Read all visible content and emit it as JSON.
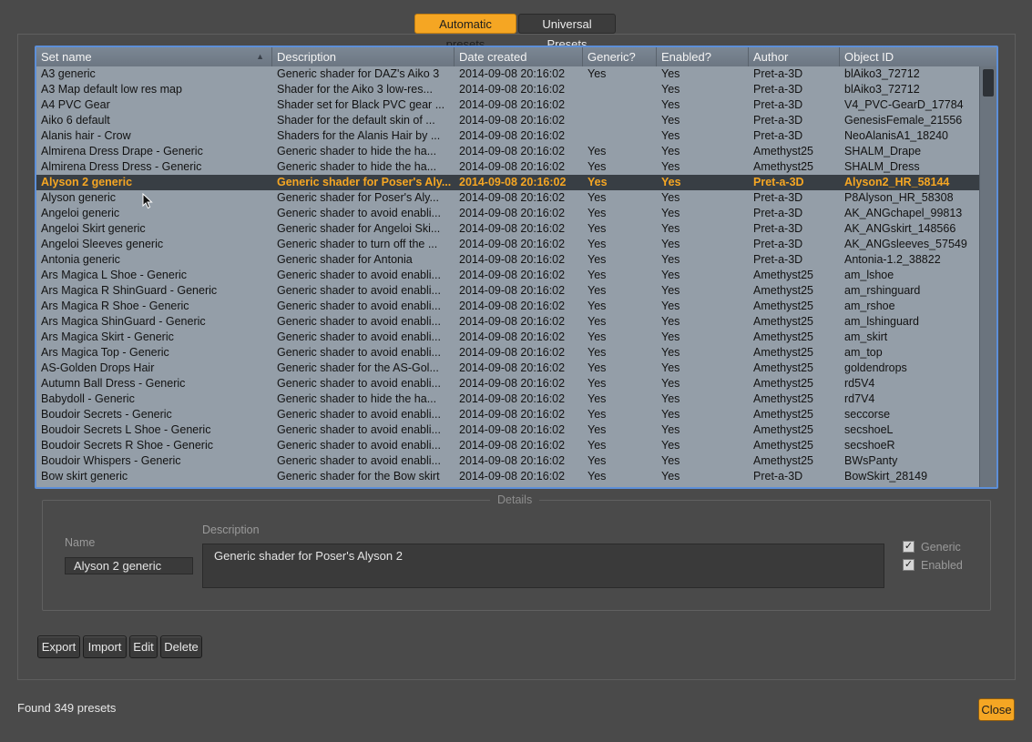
{
  "tabs": [
    {
      "label": "Automatic presets",
      "active": true
    },
    {
      "label": "Universal Presets",
      "active": false
    }
  ],
  "table": {
    "columns": [
      "Set name",
      "Description",
      "Date created",
      "Generic?",
      "Enabled?",
      "Author",
      "Object ID"
    ],
    "sorted_column": "Set name",
    "sort_direction": "ascending",
    "selected_index": 7,
    "rows": [
      [
        "A3 generic",
        "Generic shader for DAZ's Aiko 3",
        "2014-09-08 20:16:02",
        "Yes",
        "Yes",
        "Pret-a-3D",
        "blAiko3_72712"
      ],
      [
        "A3 Map default low res map",
        "Shader for the Aiko 3 low-res...",
        "2014-09-08 20:16:02",
        "",
        "Yes",
        "Pret-a-3D",
        "blAiko3_72712"
      ],
      [
        "A4 PVC Gear",
        "Shader set for Black PVC gear ...",
        "2014-09-08 20:16:02",
        "",
        "Yes",
        "Pret-a-3D",
        "V4_PVC-GearD_17784"
      ],
      [
        "Aiko 6 default",
        "Shader for the default skin of ...",
        "2014-09-08 20:16:02",
        "",
        "Yes",
        "Pret-a-3D",
        "GenesisFemale_21556"
      ],
      [
        "Alanis hair - Crow",
        "Shaders for the Alanis Hair by ...",
        "2014-09-08 20:16:02",
        "",
        "Yes",
        "Pret-a-3D",
        "NeoAlanisA1_18240"
      ],
      [
        "Almirena Dress Drape - Generic",
        "Generic shader to  hide the ha...",
        "2014-09-08 20:16:02",
        "Yes",
        "Yes",
        "Amethyst25",
        "SHALM_Drape"
      ],
      [
        "Almirena Dress Dress - Generic",
        "Generic shader to  hide the ha...",
        "2014-09-08 20:16:02",
        "Yes",
        "Yes",
        "Amethyst25",
        "SHALM_Dress"
      ],
      [
        "Alyson 2 generic",
        "Generic shader for Poser's Aly...",
        "2014-09-08 20:16:02",
        "Yes",
        "Yes",
        "Pret-a-3D",
        "Alyson2_HR_58144"
      ],
      [
        "Alyson generic",
        "Generic shader for Poser's Aly...",
        "2014-09-08 20:16:02",
        "Yes",
        "Yes",
        "Pret-a-3D",
        "P8Alyson_HR_58308"
      ],
      [
        "Angeloi generic",
        "Generic shader to avoid enabli...",
        "2014-09-08 20:16:02",
        "Yes",
        "Yes",
        "Pret-a-3D",
        "AK_ANGchapel_99813"
      ],
      [
        "Angeloi Skirt generic",
        "Generic shader for Angeloi Ski...",
        "2014-09-08 20:16:02",
        "Yes",
        "Yes",
        "Pret-a-3D",
        "AK_ANGskirt_148566"
      ],
      [
        "Angeloi Sleeves generic",
        "Generic shader to turn off the ...",
        "2014-09-08 20:16:02",
        "Yes",
        "Yes",
        "Pret-a-3D",
        "AK_ANGsleeves_57549"
      ],
      [
        "Antonia generic",
        "Generic shader for Antonia",
        "2014-09-08 20:16:02",
        "Yes",
        "Yes",
        "Pret-a-3D",
        "Antonia-1.2_38822"
      ],
      [
        "Ars Magica L Shoe - Generic",
        "Generic shader to avoid enabli...",
        "2014-09-08 20:16:02",
        "Yes",
        "Yes",
        "Amethyst25",
        "am_lshoe"
      ],
      [
        "Ars Magica R ShinGuard - Generic",
        "Generic shader to avoid enabli...",
        "2014-09-08 20:16:02",
        "Yes",
        "Yes",
        "Amethyst25",
        "am_rshinguard"
      ],
      [
        "Ars Magica R Shoe - Generic",
        "Generic shader to avoid enabli...",
        "2014-09-08 20:16:02",
        "Yes",
        "Yes",
        "Amethyst25",
        "am_rshoe"
      ],
      [
        "Ars Magica ShinGuard - Generic",
        "Generic shader to avoid enabli...",
        "2014-09-08 20:16:02",
        "Yes",
        "Yes",
        "Amethyst25",
        "am_lshinguard"
      ],
      [
        "Ars Magica Skirt - Generic",
        "Generic shader to avoid enabli...",
        "2014-09-08 20:16:02",
        "Yes",
        "Yes",
        "Amethyst25",
        "am_skirt"
      ],
      [
        "Ars Magica Top - Generic",
        "Generic shader to avoid enabli...",
        "2014-09-08 20:16:02",
        "Yes",
        "Yes",
        "Amethyst25",
        "am_top"
      ],
      [
        "AS-Golden Drops Hair",
        "Generic shader for the AS-Gol...",
        "2014-09-08 20:16:02",
        "Yes",
        "Yes",
        "Amethyst25",
        "goldendrops"
      ],
      [
        "Autumn Ball Dress - Generic",
        "Generic shader to avoid enabli...",
        "2014-09-08 20:16:02",
        "Yes",
        "Yes",
        "Amethyst25",
        "rd5V4"
      ],
      [
        "Babydoll - Generic",
        "Generic shader to hide the ha...",
        "2014-09-08 20:16:02",
        "Yes",
        "Yes",
        "Amethyst25",
        "rd7V4"
      ],
      [
        "Boudoir Secrets - Generic",
        "Generic shader to avoid enabli...",
        "2014-09-08 20:16:02",
        "Yes",
        "Yes",
        "Amethyst25",
        "seccorse"
      ],
      [
        "Boudoir Secrets L Shoe - Generic",
        "Generic shader to avoid enabli...",
        "2014-09-08 20:16:02",
        "Yes",
        "Yes",
        "Amethyst25",
        "secshoeL"
      ],
      [
        "Boudoir Secrets R Shoe - Generic",
        "Generic shader to avoid enabli...",
        "2014-09-08 20:16:02",
        "Yes",
        "Yes",
        "Amethyst25",
        "secshoeR"
      ],
      [
        "Boudoir Whispers - Generic",
        "Generic shader to avoid enabli...",
        "2014-09-08 20:16:02",
        "Yes",
        "Yes",
        "Amethyst25",
        "BWsPanty"
      ],
      [
        "Bow skirt generic",
        "Generic shader for the Bow skirt",
        "2014-09-08 20:16:02",
        "Yes",
        "Yes",
        "Pret-a-3D",
        "BowSkirt_28149"
      ]
    ]
  },
  "details": {
    "legend": "Details",
    "name_label": "Name",
    "name_value": "Alyson 2 generic",
    "description_label": "Description",
    "description_value": "Generic shader for Poser's Alyson 2",
    "generic_label": "Generic",
    "generic_checked": true,
    "enabled_label": "Enabled",
    "enabled_checked": true
  },
  "buttons": {
    "export": "Export",
    "import": "Import",
    "edit": "Edit",
    "delete": "Delete",
    "close": "Close"
  },
  "status": "Found 349 presets",
  "colors": {
    "accent": "#f5a623",
    "table_bg": "#949ea8",
    "selected_row_bg": "#383e44",
    "table_border": "#5d8fd8"
  }
}
